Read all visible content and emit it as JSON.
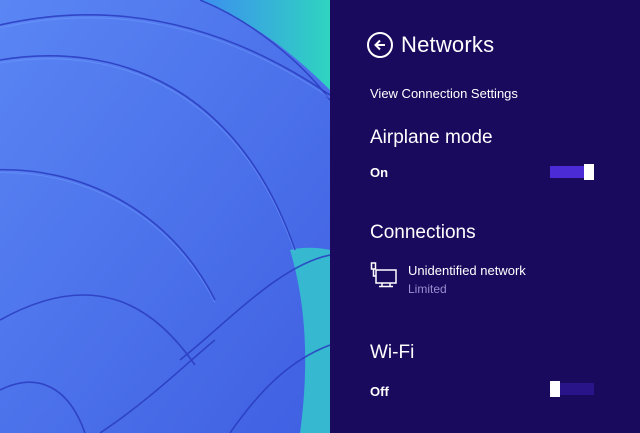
{
  "pane": {
    "title": "Networks",
    "view_connection_settings": "View Connection Settings",
    "airplane_mode": {
      "title": "Airplane mode",
      "state": "On",
      "enabled": true
    },
    "connections": {
      "title": "Connections",
      "items": [
        {
          "name": "Unidentified network",
          "status": "Limited",
          "icon": "wired-network-icon"
        }
      ]
    },
    "wifi": {
      "title": "Wi-Fi",
      "state": "Off",
      "enabled": false
    }
  },
  "colors": {
    "pane_background": "#1a0a5e",
    "toggle_on": "#4a2bd6",
    "toggle_off": "#2a148a",
    "secondary_text": "#9a8fd0",
    "wallpaper_blue": "#4c73f0",
    "wallpaper_teal": "#39d0b3"
  }
}
